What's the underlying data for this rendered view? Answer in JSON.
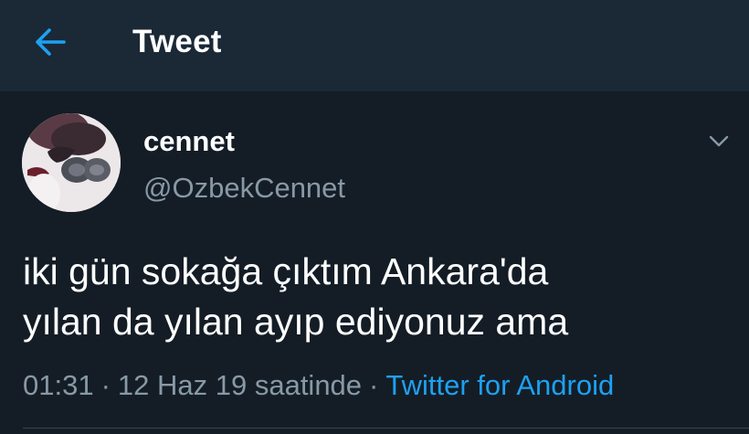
{
  "header": {
    "title": "Tweet"
  },
  "tweet": {
    "display_name": "cennet",
    "username": "@OzbekCennet",
    "text_line1": "iki gün sokağa çıktım Ankara'da",
    "text_line2": "yılan da yılan ayıp ediyonuz ama",
    "time": "01:31",
    "separator": "·",
    "date": "12 Haz 19 saatinde",
    "source": "Twitter for Android"
  },
  "icons": {
    "back": "arrow-left-icon",
    "more": "chevron-down-icon"
  },
  "colors": {
    "background": "#141d26",
    "header_background": "#1b2836",
    "accent": "#1da1f2",
    "secondary_text": "#8899a6"
  }
}
